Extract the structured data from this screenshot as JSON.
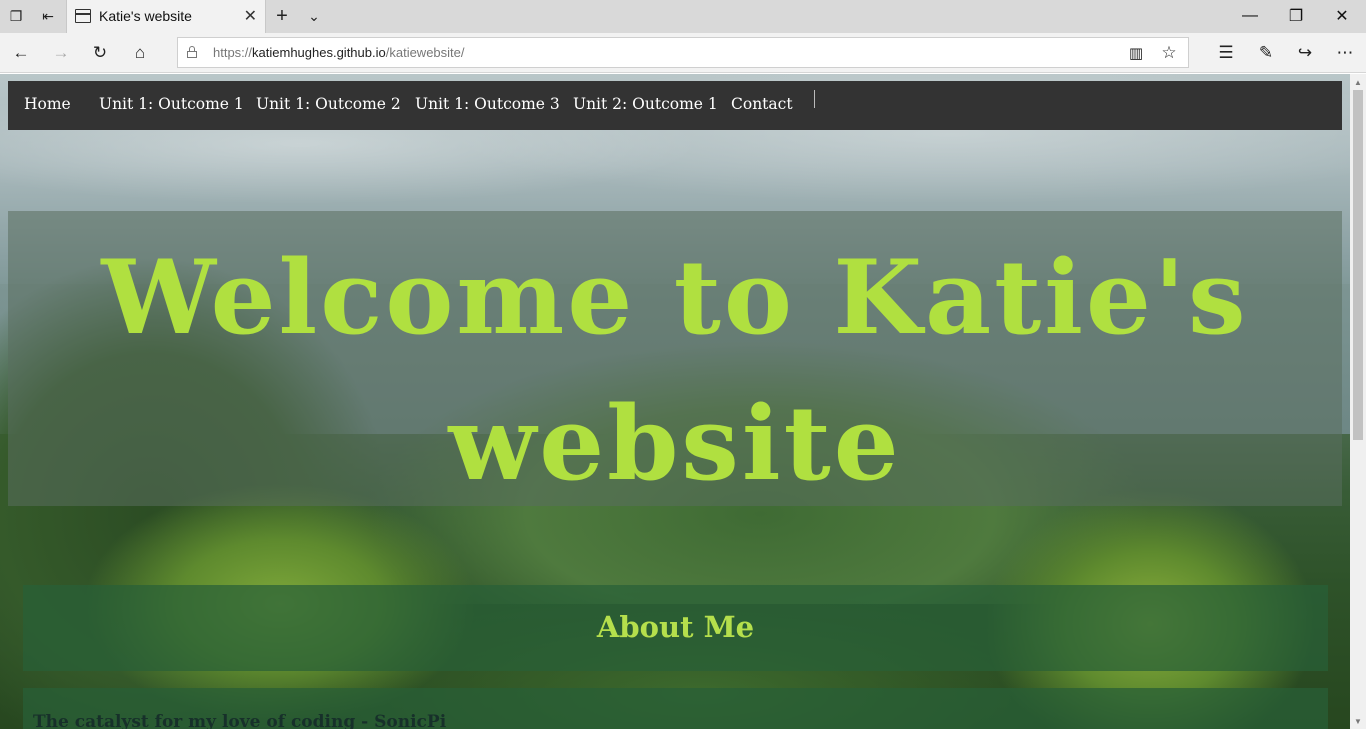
{
  "browser": {
    "tab_title": "Katie's website",
    "url_prefix": "https://",
    "url_host": "katiemhughes.github.io",
    "url_path": "/katiewebsite/",
    "icons": {
      "tab_actions": "❐",
      "set_aside": "⇤",
      "tab_close": "✕",
      "new_tab": "+",
      "tab_list": "⌄",
      "minimize": "—",
      "restore": "❐",
      "window_close": "✕",
      "back": "←",
      "forward": "→",
      "refresh": "↻",
      "home": "⌂",
      "reading_view": "▥",
      "favorite": "☆",
      "favorites_hub": "☰",
      "web_note": "✎",
      "share": "↪",
      "more": "⋯",
      "scroll_up": "▲",
      "scroll_down": "▼"
    }
  },
  "site": {
    "nav": [
      "Home",
      "Unit 1: Outcome 1",
      "Unit 1: Outcome 2",
      "Unit 1: Outcome 3",
      "Unit 2: Outcome 1",
      "Contact"
    ],
    "hero_title": "Welcome to Katie's website",
    "section_title": "About Me",
    "subheading": "The catalyst for my love of coding - SonicPi"
  },
  "colors": {
    "accent_green": "#b0e040",
    "nav_bg": "#333333"
  }
}
